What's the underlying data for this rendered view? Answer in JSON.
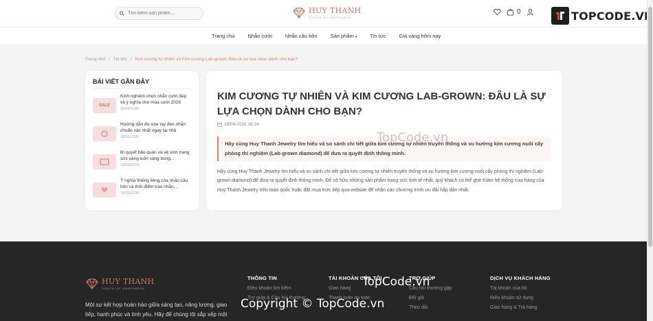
{
  "header": {
    "search_placeholder": "Tìm kiếm sản phẩm...",
    "brand_name": "HUY THANH",
    "brand_tagline": "TOUCH OF HAPPINESS",
    "cart_count": "0",
    "topcode_logo": "TOPCODE.VN"
  },
  "nav": {
    "items": [
      "Trang chủ",
      "Nhẫn cưới",
      "Nhẫn cầu hôn",
      "Sản phẩm",
      "Tin tức",
      "Giá vàng hôm nay"
    ]
  },
  "breadcrumb": {
    "home": "Trang chủ",
    "sep": "/",
    "news": "Tin tức",
    "current": "Kim cương tự nhiên và Kim cương Lab-grown: Đâu là sự lựa chọn dành cho bạn?"
  },
  "sidebar": {
    "title": "BÀI VIẾT GẦN ĐÂY",
    "posts": [
      {
        "title": "Kinh nghiệm chọn nhẫn cưới đẹp và ý nghĩa cho mùa cưới 2026",
        "date": "18/06/2026",
        "thumb": "SALE"
      },
      {
        "title": "Hướng dẫn đo size tay đeo nhẫn chuẩn xác nhất ngay tại nhà",
        "date": "18/06/2026",
        "thumb": ""
      },
      {
        "title": "Bí quyết bảo quản và vệ sinh trang sức vàng luôn sáng bóng...",
        "date": "18/06/2026",
        "thumb": ""
      },
      {
        "title": "Ý nghĩa thiêng liêng của nhẫn cầu hôn và thời điểm trao nhẫn...",
        "date": "18/06/2026",
        "thumb": ""
      }
    ]
  },
  "article": {
    "title": "KIM CƯƠNG TỰ NHIÊN VÀ KIM CƯƠNG LAB-GROWN: ĐÂU LÀ SỰ LỰA CHỌN DÀNH CHO BẠN?",
    "date": "18/06/2026 16:24",
    "lead": "Hãy cùng Huy Thanh Jewelry tìm hiểu và so sánh chi tiết giữa kim cương tự nhiên truyền thống và xu hướng kim cương nuôi cấy phòng thí nghiệm (Lab-grown diamond) để đưa ra quyết định thông minh.",
    "body": "Hãy cùng Huy Thanh Jewelry tìm hiểu và so sánh chi tiết giữa kim cương tự nhiên truyền thống và xu hướng kim cương nuôi cấy phòng thí nghiệm (Lab-grown diamond) để đưa ra quyết định thông minh. Để sở hữu những sản phẩm trang sức tinh tế nhất, quý khách có thể ghé thăm hệ thống cửa hàng của Huy Thanh Jewelry trên toàn quốc hoặc đặt mua trực tiếp qua website để nhận các chương trình ưu đãi hấp dẫn nhất."
  },
  "footer": {
    "brand_name": "HUY THANH",
    "brand_tagline": "TOUCH OF HAPPINESS",
    "description": "Một sự kết hợp hoàn hảo giữa sáng tạo, năng lượng, giao tiếp, hạnh phúc và tình yêu. Hãy để chúng tôi sắp xếp một",
    "columns": [
      {
        "title": "THÔNG TIN",
        "items": [
          "Điều khoản tìm kiếm",
          "Trợ giúp & Câu hỏi thường"
        ]
      },
      {
        "title": "TÀI KHOẢN CỦA TÔI",
        "items": [
          "Giao hàng",
          "Thanh toán an toàn"
        ]
      },
      {
        "title": "TRỢ GIÚP",
        "items": [
          "Câu hỏi thường gặp",
          "Đổi giá",
          "Theo dõi"
        ]
      },
      {
        "title": "DỊCH VỤ KHÁCH HÀNG",
        "items": [
          "Tài khoản của tôi",
          "Điều khoản sử dụng",
          "Giao hàng & Trả hàng"
        ]
      }
    ]
  },
  "watermarks": {
    "wm1": "TopCode.vn",
    "wm2": "TopCode.vn",
    "wm3": "Copyright © TopCode.vn"
  },
  "colors": {
    "accent": "#d9826c",
    "footer_bg": "#262626",
    "page_bg": "#f4f4f4"
  }
}
